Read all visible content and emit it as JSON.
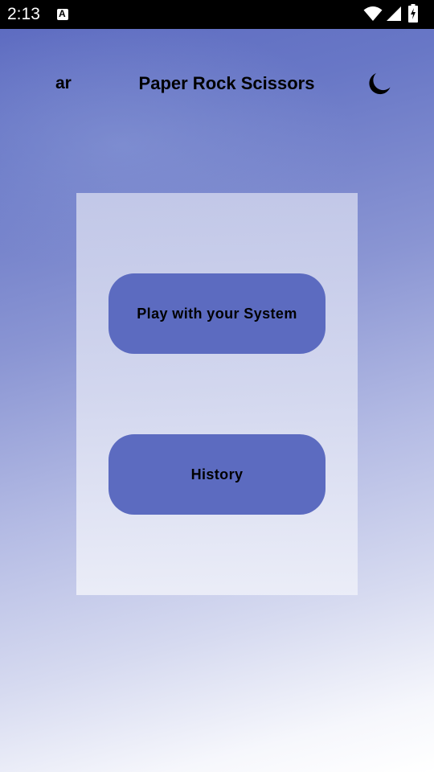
{
  "status_bar": {
    "time": "2:13",
    "notification_icon": "a-notification-icon",
    "icons": [
      "wifi-icon",
      "cellular-signal-icon",
      "battery-charging-icon"
    ]
  },
  "header": {
    "language_label": "ar",
    "title": "Paper Rock Scissors",
    "theme_icon": "moon-icon"
  },
  "menu": {
    "play_label": "Play with your System",
    "history_label": "History"
  },
  "colors": {
    "button": "#5c6bc0",
    "background_top": "#5c6ac0",
    "background_bottom": "#ffffff",
    "status_bar": "#000000"
  }
}
